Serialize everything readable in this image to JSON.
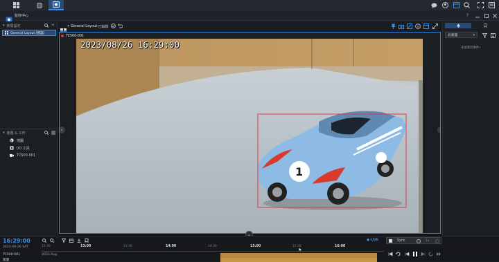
{
  "app": {
    "title": "監控中心"
  },
  "topbar": {
    "colors": {
      "active": "#2b4b74",
      "accent": "#3a8ee6"
    }
  },
  "left": {
    "section1": {
      "label": "佈局設定"
    },
    "layout_item": {
      "label": "General Layout (預設)"
    },
    "section2": {
      "label": "裝置 & 工作"
    },
    "tree": [
      {
        "label": "地圖",
        "icon": "globe-icon"
      },
      {
        "label": "I/O 工具",
        "icon": "io-icon"
      },
      {
        "label": "TC500-001",
        "icon": "camera-icon"
      }
    ]
  },
  "view": {
    "layout_name": "General Layout",
    "status": "- 已編輯",
    "camera_label": "TC500-001",
    "osd_timestamp": "2023/08/26 16:29:00"
  },
  "right": {
    "dropdown_value": "此版面",
    "empty_text": "未偵測到事件•"
  },
  "timeline": {
    "current_time": "16:29:00",
    "date": "2023-08-26 SAT",
    "camera": "TC500-001",
    "row2": "版面",
    "month": "2023.Aug",
    "live": "● LIVE",
    "sync": "Sync",
    "speed": "1x",
    "ticks": [
      "12:30",
      "13:00",
      "13:30",
      "14:00",
      "14:30",
      "15:00",
      "15:30",
      "16:00"
    ]
  }
}
